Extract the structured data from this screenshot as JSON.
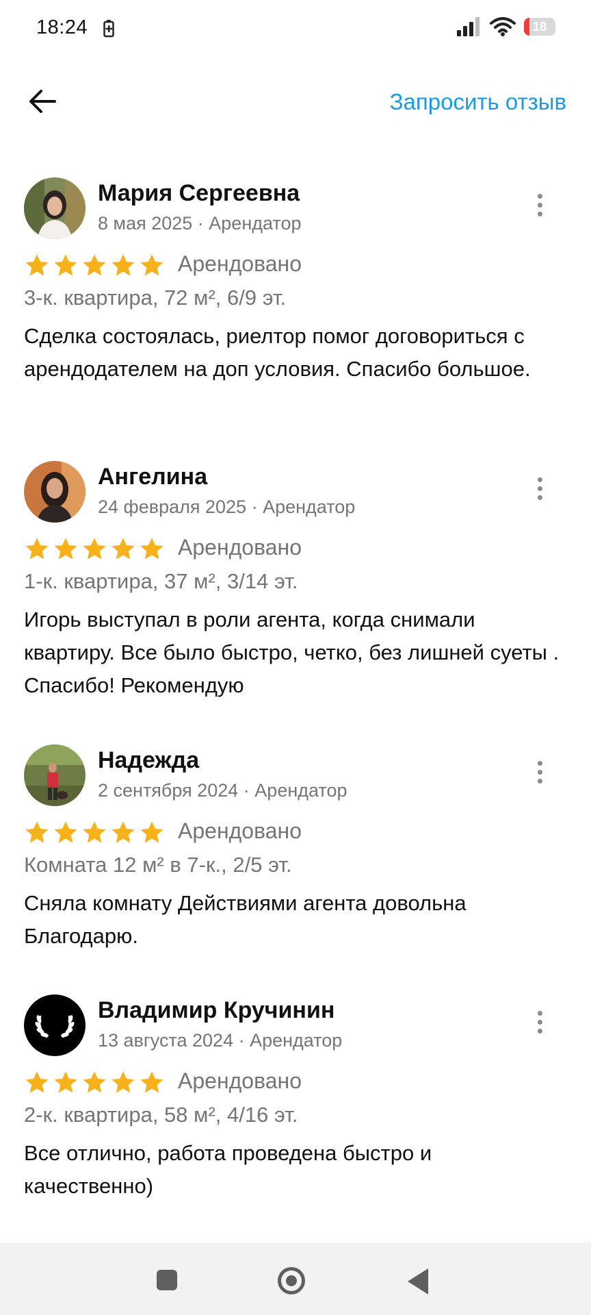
{
  "status_bar": {
    "time": "18:24",
    "battery_level": "18",
    "battery_color": "#ee3b3b",
    "icons": [
      "battery-saver-icon",
      "signal-icon",
      "wifi-icon",
      "battery-icon"
    ]
  },
  "header": {
    "back_icon": "arrow-left-icon",
    "request_review_label": "Запросить отзыв",
    "accent_color": "#1a9be6"
  },
  "reviews": [
    {
      "name": "Мария Сергеевна",
      "meta": "8 мая 2025 · Арендатор",
      "rating": 5,
      "status": "Арендовано",
      "property": "3-к. квартира, 72 м², 6/9 эт.",
      "text": "Сделка состоялась, риелтор помог договориться с арендодателем на доп условия. Спасибо большое."
    },
    {
      "name": "Ангелина",
      "meta": "24 февраля 2025 · Арендатор",
      "rating": 5,
      "status": "Арендовано",
      "property": "1-к. квартира, 37 м², 3/14 эт.",
      "text": "Игорь выступал в роли агента, когда снимали квартиру. Все было быстро, четко, без лишней суеты . Спасибо! Рекомендую"
    },
    {
      "name": "Надежда",
      "meta": "2 сентября 2024 · Арендатор",
      "rating": 5,
      "status": "Арендовано",
      "property": "Комната 12 м² в 7-к., 2/5 эт.",
      "text": "Сняла комнату Действиями агента довольна Благодарю."
    },
    {
      "name": "Владимир Кручинин",
      "meta": "13 августа 2024 · Арендатор",
      "rating": 5,
      "status": "Арендовано",
      "property": "2-к. квартира, 58 м², 4/16 эт.",
      "text": "Все отлично, работа проведена быстро и качественно)"
    }
  ],
  "star_color": "#f7b21b",
  "nav_bar": {
    "icons": [
      "recent-apps-icon",
      "home-icon",
      "back-triangle-icon"
    ]
  }
}
